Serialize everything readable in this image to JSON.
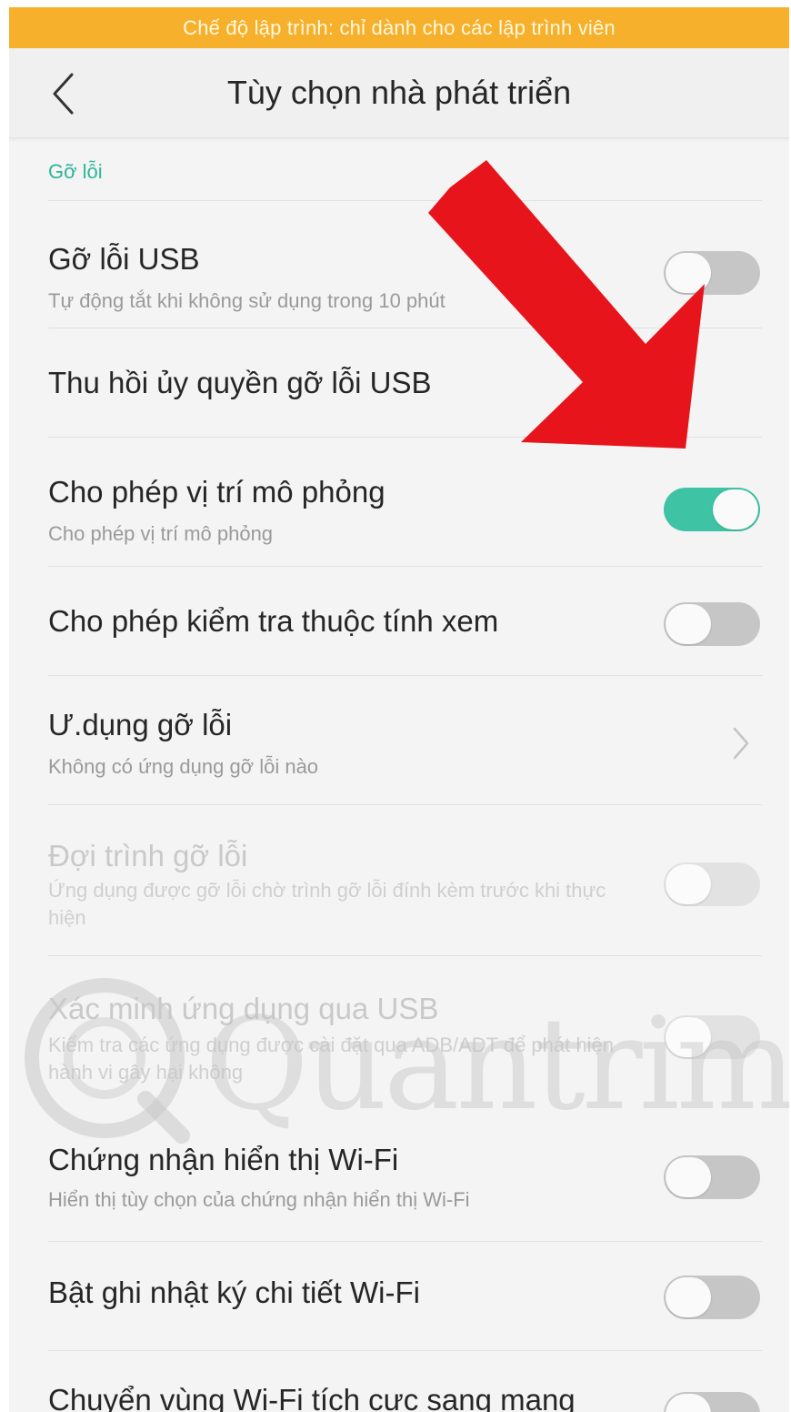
{
  "banner": {
    "text": "Chế độ lập trình: chỉ dành cho các lập trình viên",
    "color": "#f6b02b"
  },
  "header": {
    "title": "Tùy chọn nhà phát triển",
    "back_icon": "chevron-left-icon"
  },
  "section": {
    "label": "Gỡ lỗi",
    "accent_color": "#2db59b"
  },
  "settings": [
    {
      "title": "Gỡ lỗi USB",
      "subtitle": "Tự động tắt khi không sử dụng trong 10 phút",
      "control": "toggle",
      "on": false,
      "disabled": false
    },
    {
      "title": "Thu hồi ủy quyền gỡ lỗi USB",
      "subtitle": "",
      "control": "none",
      "disabled": false
    },
    {
      "title": "Cho phép vị trí mô phỏng",
      "subtitle": "Cho phép vị trí mô phỏng",
      "control": "toggle",
      "on": true,
      "disabled": false
    },
    {
      "title": "Cho phép kiểm tra thuộc tính xem",
      "subtitle": "",
      "control": "toggle",
      "on": false,
      "disabled": false
    },
    {
      "title": "Ư.dụng gỡ lỗi",
      "subtitle": "Không có ứng dụng gỡ lỗi nào",
      "control": "chevron",
      "disabled": false
    },
    {
      "title": "Đợi trình gỡ lỗi",
      "subtitle": "Ứng dụng được gỡ lỗi chờ trình gỡ lỗi đính kèm trước khi thực hiện",
      "control": "toggle",
      "on": false,
      "disabled": true
    },
    {
      "title": "Xác minh ứng dụng qua USB",
      "subtitle": "Kiểm tra các ứng dụng được cài đặt qua ADB/ADT để phát hiện hành vi gây hại không",
      "control": "toggle",
      "on": false,
      "disabled": true
    },
    {
      "title": "Chứng nhận hiển thị Wi-Fi",
      "subtitle": "Hiển thị tùy chọn của chứng nhận hiển thị Wi-Fi",
      "control": "toggle",
      "on": false,
      "disabled": false
    },
    {
      "title": "Bật ghi nhật ký chi tiết Wi-Fi",
      "subtitle": "",
      "control": "toggle",
      "on": false,
      "disabled": false
    },
    {
      "title": "Chuyển vùng Wi-Fi tích cực sang mạng",
      "subtitle": "",
      "control": "toggle",
      "on": false,
      "disabled": false
    }
  ],
  "watermark": {
    "text": "Quantrimang"
  },
  "annotation": {
    "arrow_color": "#e8141b",
    "icon": "red-arrow-icon"
  }
}
